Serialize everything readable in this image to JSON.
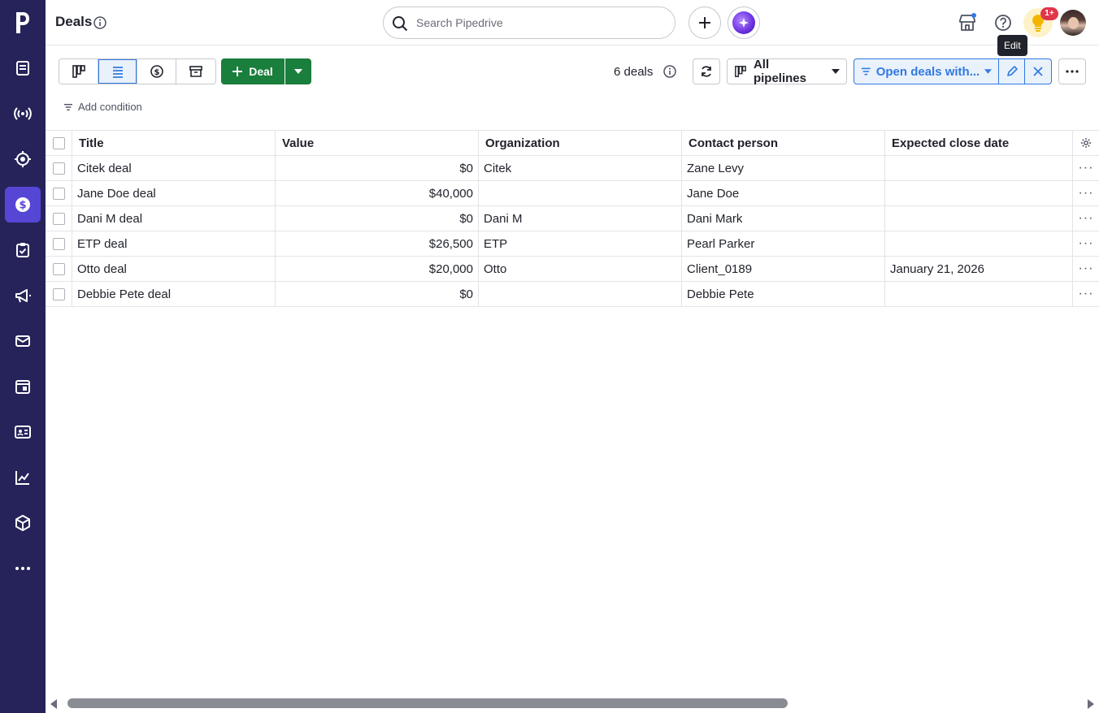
{
  "header": {
    "title": "Deals",
    "search_placeholder": "Search Pipedrive",
    "notification_badge": "1+",
    "tooltip": "Edit"
  },
  "toolbar": {
    "deal_button_label": "Deal",
    "deal_count": "6 deals",
    "pipeline_label": "All pipelines",
    "filter_label": "Open deals with...",
    "add_condition_label": "Add condition",
    "accent_color": "#317ae2",
    "primary_color": "#1a7e3c"
  },
  "sidebar": {
    "bg_color": "#26235a",
    "active_color": "#5546d6",
    "items": [
      {
        "icon": "leads-icon"
      },
      {
        "icon": "broadcast-icon"
      },
      {
        "icon": "target-icon"
      },
      {
        "icon": "deals-dollar-icon",
        "active": true
      },
      {
        "icon": "activities-icon"
      },
      {
        "icon": "campaigns-icon"
      },
      {
        "icon": "mail-icon"
      },
      {
        "icon": "calendar-icon"
      },
      {
        "icon": "contacts-icon"
      },
      {
        "icon": "insights-icon"
      },
      {
        "icon": "products-icon"
      },
      {
        "icon": "more-icon"
      }
    ]
  },
  "table": {
    "columns": [
      "Title",
      "Value",
      "Organization",
      "Contact person",
      "Expected close date"
    ],
    "rows": [
      {
        "title": "Citek deal",
        "value": "$0",
        "org": "Citek",
        "contact": "Zane Levy",
        "close": ""
      },
      {
        "title": "Jane Doe deal",
        "value": "$40,000",
        "org": "",
        "contact": "Jane Doe",
        "close": ""
      },
      {
        "title": "Dani M deal",
        "value": "$0",
        "org": "Dani M",
        "contact": "Dani Mark",
        "close": ""
      },
      {
        "title": "ETP deal",
        "value": "$26,500",
        "org": "ETP",
        "contact": "Pearl Parker",
        "close": ""
      },
      {
        "title": "Otto deal",
        "value": "$20,000",
        "org": "Otto",
        "contact": "Client_0189",
        "close": "January 21, 2026"
      },
      {
        "title": "Debbie Pete deal",
        "value": "$0",
        "org": "",
        "contact": "Debbie Pete",
        "close": ""
      }
    ]
  }
}
